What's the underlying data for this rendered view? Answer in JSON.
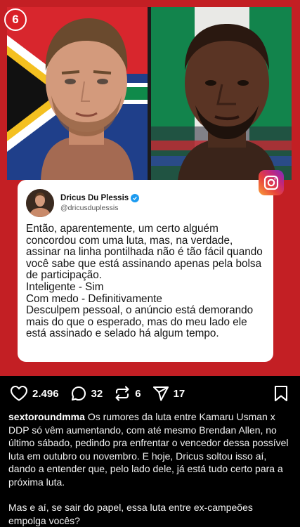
{
  "post": {
    "brand_badge": "6",
    "tweet": {
      "name": "Dricus Du Plessis",
      "handle": "@dricusduplessis",
      "body": "Então, aparentemente, um certo alguém concordou com uma luta, mas, na verdade, assinar na linha pontilhada não é tão fácil quando você sabe que está assinando apenas pela bolsa de participação.\nInteligente - Sim\nCom medo - Definitivamente\nDesculpem pessoal, o anúncio está demorando mais do que o esperado, mas do meu lado ele está assinado e selado há algum tempo."
    }
  },
  "actions": {
    "likes": "2.496",
    "comments": "32",
    "reposts": "6",
    "shares": "17"
  },
  "caption": {
    "username": "sextoroundmma",
    "text": "Os rumores da luta entre Kamaru Usman x DDP só vêm aumentando, com até mesmo Brendan Allen, no último sábado, pedindo pra enfrentar o vencedor dessa possível luta em outubro ou novembro. E hoje, Dricus soltou isso aí, dando a entender que, pelo lado dele, já está tudo certo para a próxima luta.",
    "text2": "Mas e aí, se sair do papel, essa luta entre ex-campeões empolga vocês?"
  },
  "colors": {
    "frame_red": "#c31f24",
    "verified_blue": "#1d9bf0"
  }
}
